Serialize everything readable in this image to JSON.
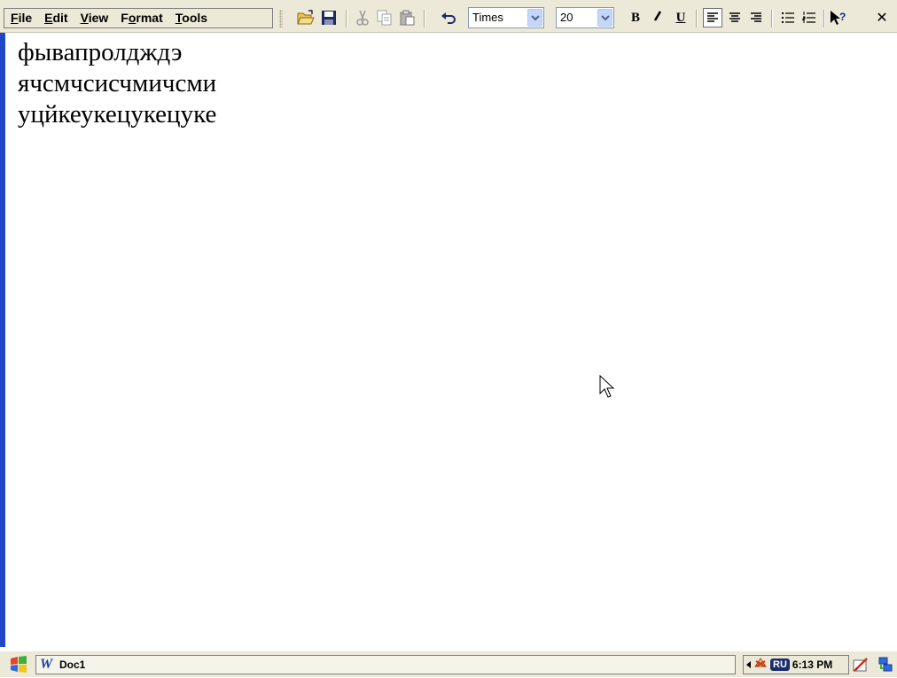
{
  "menu": {
    "file": {
      "u": "F",
      "rest": "ile"
    },
    "edit": {
      "u": "E",
      "rest": "dit"
    },
    "view": {
      "u": "V",
      "rest": "iew"
    },
    "format": {
      "pre": "F",
      "u": "o",
      "rest": "rmat"
    },
    "tools": {
      "u": "T",
      "rest": "ools"
    }
  },
  "toolbar": {
    "font_name": "Times",
    "font_size": "20",
    "bold_label": "B",
    "underline_label": "U",
    "close_label": "✕"
  },
  "icons": {
    "open": "open-folder-icon",
    "save": "save-disk-icon",
    "cut": "scissors-icon",
    "copy": "copy-icon",
    "paste": "paste-icon",
    "undo": "undo-icon",
    "italic": "italic-icon",
    "align_left": "align-left-icon",
    "align_center": "align-center-icon",
    "align_right": "align-right-icon",
    "bullets": "bullets-icon",
    "numbering": "numbering-icon",
    "help": "help-pointer-icon"
  },
  "document": {
    "lines": [
      "фывапролдждэ",
      "ячсмчсисчмичсми",
      "уцйкеукецукецуке"
    ]
  },
  "taskbar": {
    "task_label": "Doc1",
    "input_lang": "RU",
    "clock": "6:13 PM"
  },
  "colors": {
    "left_border": "#1f47c8",
    "toolbar_bg": "#ece9d8",
    "combo_arrow": "#c5d6fb"
  }
}
